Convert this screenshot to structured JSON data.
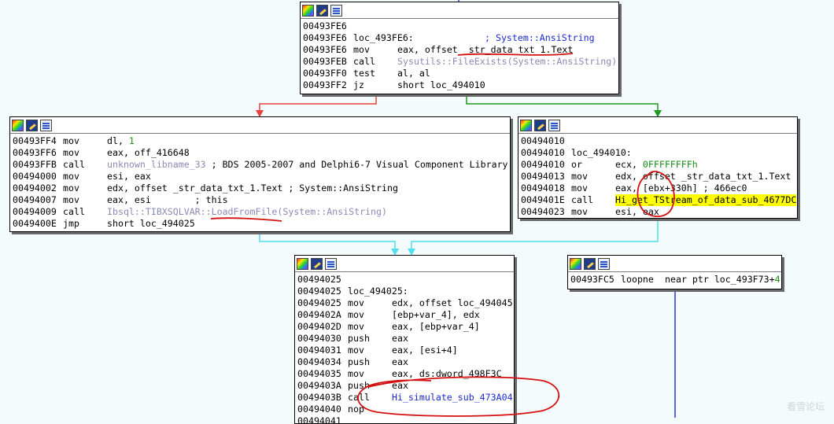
{
  "blocks": {
    "top": {
      "rows": [
        {
          "addr": "00493FE6"
        },
        {
          "addr": "00493FE6",
          "label": "loc_493FE6:",
          "comment": "; System::AnsiString"
        },
        {
          "addr": "00493FE6",
          "mn": "mov",
          "op": "eax, offset _str_data_txt_1.Text"
        },
        {
          "addr": "00493FEB",
          "mn": "call",
          "lib": "Sysutils::FileExists(System::AnsiString)"
        },
        {
          "addr": "00493FF0",
          "mn": "test",
          "op": "al, al"
        },
        {
          "addr": "00493FF2",
          "mn": "jz",
          "op": "short loc_494010"
        }
      ]
    },
    "left": {
      "rows": [
        {
          "addr": "00493FF4",
          "mn": "mov",
          "op": "dl, ",
          "num": "1"
        },
        {
          "addr": "00493FF6",
          "mn": "mov",
          "op": "eax, off_416648"
        },
        {
          "addr": "00493FFB",
          "mn": "call",
          "lib": "unknown_libname_33",
          "op2": " ; BDS 2005-2007 and Delphi6-7 Visual Component Library"
        },
        {
          "addr": "00494000",
          "mn": "mov",
          "op": "esi, eax"
        },
        {
          "addr": "00494002",
          "mn": "mov",
          "op": "edx, offset _str_data_txt_1.Text ; System::AnsiString"
        },
        {
          "addr": "00494007",
          "mn": "mov",
          "op": "eax, esi        ; this"
        },
        {
          "addr": "00494009",
          "mn": "call",
          "lib": "Ibsql::TIBXSQLVAR::LoadFromFile(System::AnsiString)"
        },
        {
          "addr": "0049400E",
          "mn": "jmp",
          "op": "short loc_494025"
        }
      ]
    },
    "right": {
      "rows": [
        {
          "addr": "00494010"
        },
        {
          "addr": "00494010",
          "label": "loc_494010:"
        },
        {
          "addr": "00494010",
          "mn": "or",
          "op": "ecx, ",
          "num": "0FFFFFFFFh"
        },
        {
          "addr": "00494013",
          "mn": "mov",
          "op": "edx, offset _str_data_txt_1.Text"
        },
        {
          "addr": "00494018",
          "mn": "mov",
          "op": "eax, [ebx+330h] ; 466ec0"
        },
        {
          "addr": "0049401E",
          "mn": "call",
          "hl": "Hi_get_TStream_of_data_sub_4677DC"
        },
        {
          "addr": "00494023",
          "mn": "mov",
          "op": "esi, eax"
        }
      ]
    },
    "bottom": {
      "rows": [
        {
          "addr": "00494025"
        },
        {
          "addr": "00494025",
          "label": "loc_494025:"
        },
        {
          "addr": "00494025",
          "mn": "mov",
          "op": "edx, offset loc_494045"
        },
        {
          "addr": "0049402A",
          "mn": "mov",
          "op": "[ebp+var_4], edx"
        },
        {
          "addr": "0049402D",
          "mn": "mov",
          "op": "eax, [ebp+var_4]"
        },
        {
          "addr": "00494030",
          "mn": "push",
          "op": "eax"
        },
        {
          "addr": "00494031",
          "mn": "mov",
          "op": "eax, [esi+4]"
        },
        {
          "addr": "00494034",
          "mn": "push",
          "op": "eax"
        },
        {
          "addr": "00494035",
          "mn": "mov",
          "op": "eax, ds:dword_498F3C"
        },
        {
          "addr": "0049403A",
          "mn": "push",
          "op": "eax"
        },
        {
          "addr": "0049403B",
          "mn": "call",
          "op": "Hi_simulate_sub_473A04"
        },
        {
          "addr": "00494040",
          "mn": "nop",
          "op": ""
        },
        {
          "addr": "00494041",
          "mn": "",
          "op": ""
        }
      ]
    },
    "far": {
      "rows": [
        {
          "addr": "00493FC5",
          "mn": "loopne",
          "op": "near ptr loc_493F73+",
          "num": "4"
        }
      ]
    }
  },
  "colors": {
    "false_edge": "#e8413a",
    "true_edge": "#1f9a1f",
    "jump_edge": "#4fe0ef",
    "annotation": "#d41111",
    "highlight": "#ffff00"
  },
  "watermark": "看雪论坛"
}
